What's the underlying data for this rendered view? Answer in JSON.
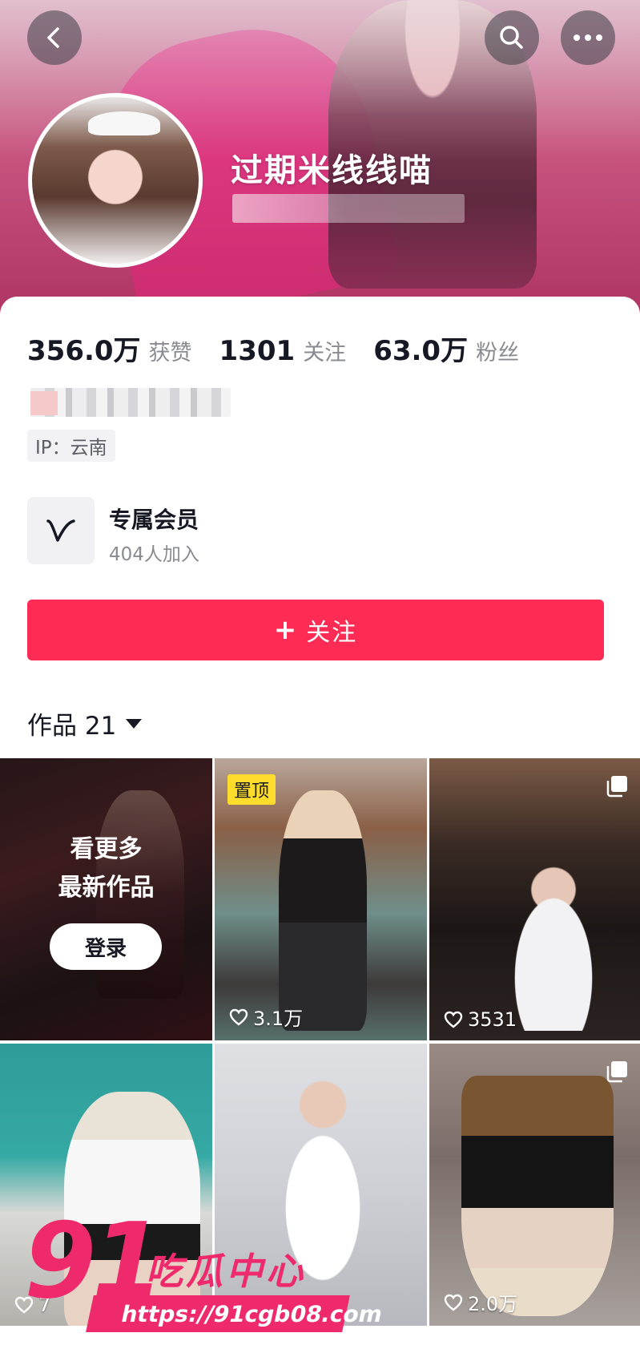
{
  "profile": {
    "name": "过期米线线喵",
    "ip": "IP：云南"
  },
  "stats": [
    {
      "value": "356.0万",
      "label": "获赞"
    },
    {
      "value": "1301",
      "label": "关注"
    },
    {
      "value": "63.0万",
      "label": "粉丝"
    }
  ],
  "membership": {
    "title": "专属会员",
    "subtitle": "404人加入"
  },
  "follow_button": {
    "plus": "+",
    "label": "关注"
  },
  "works_tab": {
    "label": "作品 21"
  },
  "grid": {
    "locked_tile": {
      "line1": "看更多",
      "line2": "最新作品",
      "login": "登录"
    },
    "tiles": [
      {
        "likes": "3.1万",
        "pinned": "置顶"
      },
      {
        "likes": "3531"
      },
      {
        "likes": "7"
      },
      {
        "likes": ""
      },
      {
        "likes": "2.0万"
      }
    ]
  },
  "watermark": {
    "number": "91",
    "text": "吃瓜中心",
    "url": "https://91cgb08.com"
  },
  "colors": {
    "accent": "#fe2c55",
    "pin_badge": "#fedc2c",
    "watermark": "#ee2a6c"
  }
}
